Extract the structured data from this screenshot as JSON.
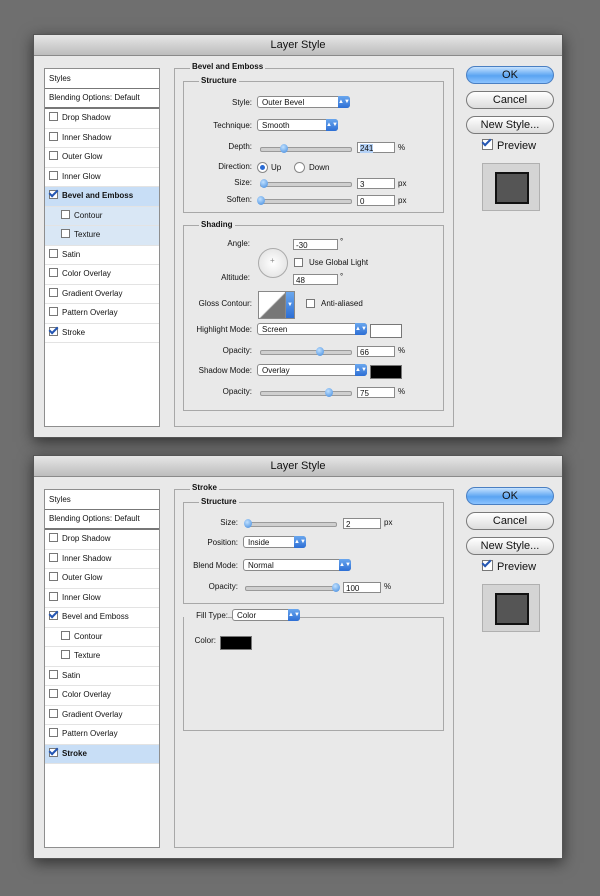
{
  "dialog1": {
    "title": "Layer Style",
    "styles_header": "Styles",
    "blending": "Blending Options: Default",
    "items": [
      {
        "label": "Drop Shadow",
        "checked": false
      },
      {
        "label": "Inner Shadow",
        "checked": false
      },
      {
        "label": "Outer Glow",
        "checked": false
      },
      {
        "label": "Inner Glow",
        "checked": false
      },
      {
        "label": "Bevel and Emboss",
        "checked": true
      },
      {
        "label": "Contour",
        "checked": false
      },
      {
        "label": "Texture",
        "checked": false
      },
      {
        "label": "Satin",
        "checked": false
      },
      {
        "label": "Color Overlay",
        "checked": false
      },
      {
        "label": "Gradient Overlay",
        "checked": false
      },
      {
        "label": "Pattern Overlay",
        "checked": false
      },
      {
        "label": "Stroke",
        "checked": true
      }
    ],
    "section_title": "Bevel and Emboss",
    "structure_title": "Structure",
    "style_label": "Style:",
    "style_value": "Outer Bevel",
    "technique_label": "Technique:",
    "technique_value": "Smooth",
    "depth_label": "Depth:",
    "depth_value": "241",
    "depth_unit": "%",
    "depth_level": 0.25,
    "direction_label": "Direction:",
    "dir_up": "Up",
    "dir_down": "Down",
    "size_label": "Size:",
    "size_value": "3",
    "size_unit": "px",
    "size_level": 0.03,
    "soften_label": "Soften:",
    "soften_value": "0",
    "soften_unit": "px",
    "soften_level": 0.0,
    "shading_title": "Shading",
    "angle_label": "Angle:",
    "angle_value": "-30",
    "angle_unit": "°",
    "global_light_label": "Use Global Light",
    "altitude_label": "Altitude:",
    "altitude_value": "48",
    "altitude_unit": "°",
    "gloss_label": "Gloss Contour:",
    "anti_aliased_label": "Anti-aliased",
    "highlight_label": "Highlight Mode:",
    "highlight_value": "Screen",
    "highlight_color": "#ffffff",
    "opacity1_label": "Opacity:",
    "opacity1_value": "66",
    "opacity1_unit": "%",
    "opacity1_level": 0.66,
    "shadow_label": "Shadow Mode:",
    "shadow_value": "Overlay",
    "shadow_color": "#000000",
    "opacity2_label": "Opacity:",
    "opacity2_value": "75",
    "opacity2_unit": "%",
    "opacity2_level": 0.75,
    "ok": "OK",
    "cancel": "Cancel",
    "new_style": "New Style...",
    "preview": "Preview"
  },
  "dialog2": {
    "title": "Layer Style",
    "styles_header": "Styles",
    "blending": "Blending Options: Default",
    "items": [
      {
        "label": "Drop Shadow",
        "checked": false
      },
      {
        "label": "Inner Shadow",
        "checked": false
      },
      {
        "label": "Outer Glow",
        "checked": false
      },
      {
        "label": "Inner Glow",
        "checked": false
      },
      {
        "label": "Bevel and Emboss",
        "checked": true
      },
      {
        "label": "Contour",
        "checked": false
      },
      {
        "label": "Texture",
        "checked": false
      },
      {
        "label": "Satin",
        "checked": false
      },
      {
        "label": "Color Overlay",
        "checked": false
      },
      {
        "label": "Gradient Overlay",
        "checked": false
      },
      {
        "label": "Pattern Overlay",
        "checked": false
      },
      {
        "label": "Stroke",
        "checked": true
      }
    ],
    "section_title": "Stroke",
    "structure_title": "Structure",
    "size_label": "Size:",
    "size_value": "2",
    "size_unit": "px",
    "size_level": 0.02,
    "position_label": "Position:",
    "position_value": "Inside",
    "blend_label": "Blend Mode:",
    "blend_value": "Normal",
    "opacity_label": "Opacity:",
    "opacity_value": "100",
    "opacity_unit": "%",
    "opacity_level": 1.0,
    "fill_type_label": "Fill Type:",
    "fill_type_value": "Color",
    "color_label": "Color:",
    "color_value": "#000000",
    "ok": "OK",
    "cancel": "Cancel",
    "new_style": "New Style...",
    "preview": "Preview"
  }
}
